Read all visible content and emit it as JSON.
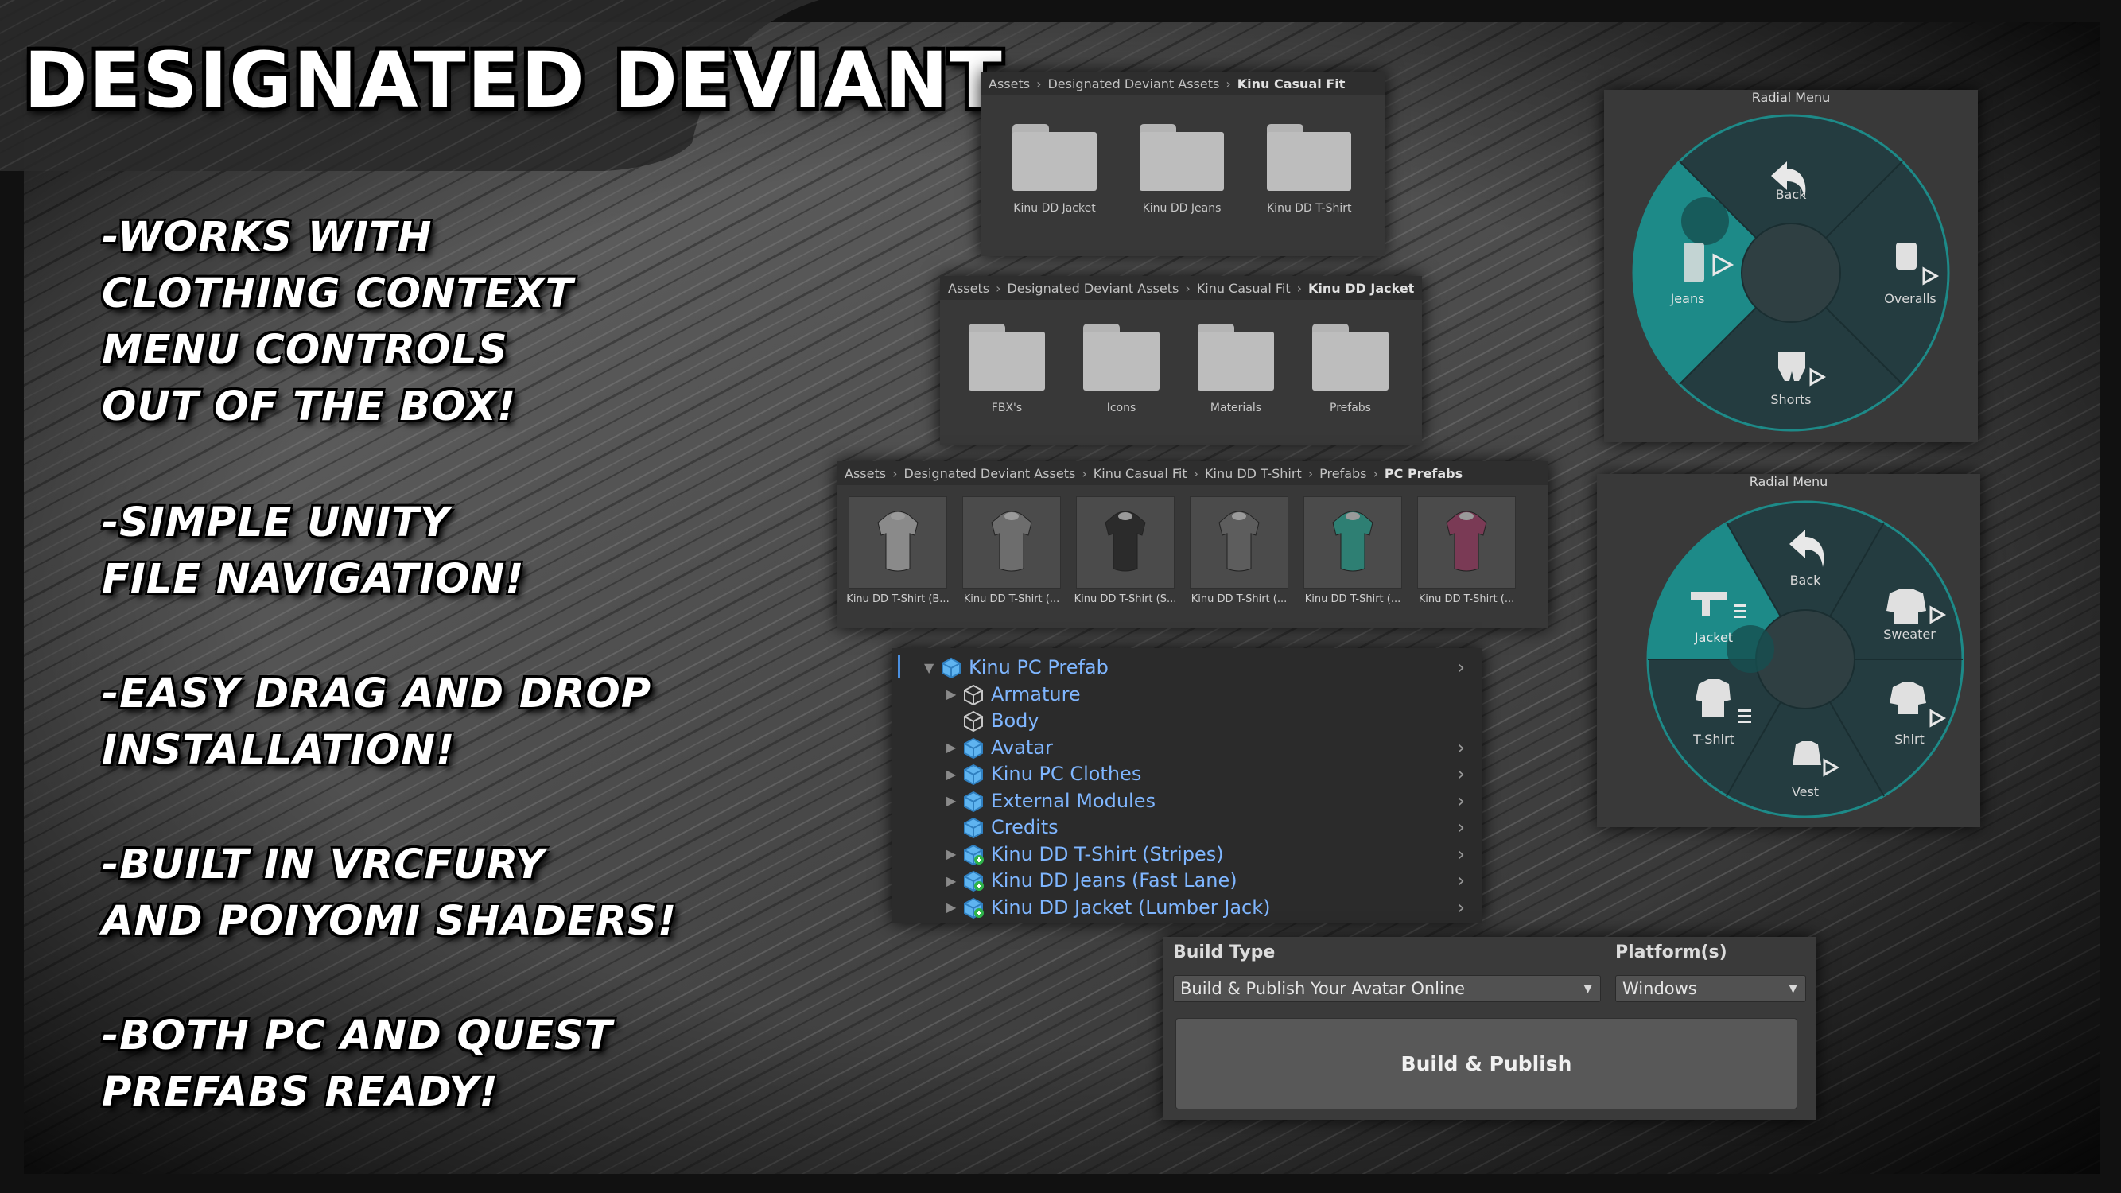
{
  "brand": {
    "title": "DESIGNATED DEVIANT"
  },
  "features": [
    [
      "-WORKS WITH",
      "CLOTHING CONTEXT",
      "MENU CONTROLS",
      "OUT OF THE BOX!"
    ],
    [
      "-SIMPLE UNITY",
      "FILE NAVIGATION!"
    ],
    [
      "-EASY DRAG AND DROP",
      "INSTALLATION!"
    ],
    [
      "-BUILT IN VRCFURY",
      "AND POIYOMI SHADERS!"
    ],
    [
      "-BOTH PC AND QUEST",
      "PREFABS READY!"
    ]
  ],
  "browser1": {
    "breadcrumb": [
      "Assets",
      "Designated Deviant Assets",
      "Kinu Casual Fit"
    ],
    "items": [
      "Kinu DD Jacket",
      "Kinu DD Jeans",
      "Kinu DD T-Shirt"
    ]
  },
  "browser2": {
    "breadcrumb": [
      "Assets",
      "Designated Deviant Assets",
      "Kinu Casual Fit",
      "Kinu DD Jacket"
    ],
    "items": [
      "FBX's",
      "Icons",
      "Materials",
      "Prefabs"
    ]
  },
  "browser3": {
    "breadcrumb": [
      "Assets",
      "Designated Deviant Assets",
      "Kinu Casual Fit",
      "Kinu DD T-Shirt",
      "Prefabs",
      "PC Prefabs"
    ],
    "items": [
      {
        "label": "Kinu DD T-Shirt (B...",
        "color": "#8a8a8a"
      },
      {
        "label": "Kinu DD T-Shirt (...",
        "color": "#6d6d6d"
      },
      {
        "label": "Kinu DD T-Shirt (S...",
        "color": "#2b2b2b"
      },
      {
        "label": "Kinu DD T-Shirt (...",
        "color": "#5d5d5d"
      },
      {
        "label": "Kinu DD T-Shirt (...",
        "color": "#2e7f73"
      },
      {
        "label": "Kinu DD T-Shirt (...",
        "color": "#7a3a55"
      }
    ]
  },
  "hierarchy": {
    "items": [
      {
        "label": "Kinu PC Prefab",
        "expanded": true
      },
      {
        "label": "Armature"
      },
      {
        "label": "Body"
      },
      {
        "label": "Avatar"
      },
      {
        "label": "Kinu PC Clothes"
      },
      {
        "label": "External Modules"
      },
      {
        "label": "Credits"
      },
      {
        "label": "Kinu DD T-Shirt (Stripes)"
      },
      {
        "label": "Kinu DD Jeans (Fast Lane)"
      },
      {
        "label": "Kinu DD Jacket (Lumber Jack)"
      }
    ]
  },
  "radial1": {
    "title": "Radial Menu",
    "items": {
      "top": "Back",
      "right": "Overalls",
      "bottom": "Shorts",
      "left": "Jeans"
    }
  },
  "radial2": {
    "title": "Radial Menu",
    "items": {
      "top": "Back",
      "upper_right": "Sweater",
      "lower_right": "Shirt",
      "bottom": "Vest",
      "lower_left": "T-Shirt",
      "upper_left": "Jacket"
    }
  },
  "build": {
    "build_type_label": "Build Type",
    "build_type_value": "Build & Publish Your Avatar Online",
    "platform_label": "Platform(s)",
    "platform_value": "Windows",
    "button_label": "Build & Publish"
  },
  "colors": {
    "accent_teal": "#1d8a88",
    "radial_bg": "#243c40",
    "link_blue": "#7fb6ff"
  }
}
